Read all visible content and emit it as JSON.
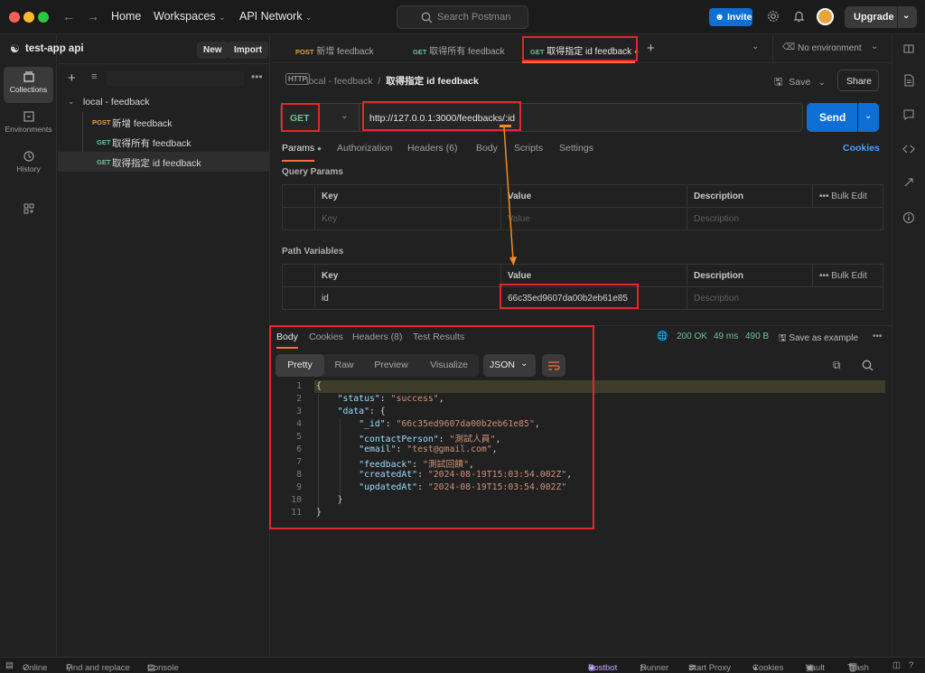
{
  "titlebar": {
    "home": "Home",
    "workspaces": "Workspaces",
    "api_network": "API Network",
    "search_placeholder": "Search Postman",
    "invite": "Invite",
    "upgrade": "Upgrade"
  },
  "rail": {
    "collections": "Collections",
    "environments": "Environments",
    "history": "History"
  },
  "sidebar": {
    "workspace_name": "test-app api",
    "new_label": "New",
    "import_label": "Import",
    "collection_name": "local - feedback",
    "items": [
      {
        "method": "POST",
        "name": "新增 feedback"
      },
      {
        "method": "GET",
        "name": "取得所有 feedback"
      },
      {
        "method": "GET",
        "name": "取得指定 id feedback"
      }
    ]
  },
  "tabs": [
    {
      "method": "POST",
      "name": "新增 feedback"
    },
    {
      "method": "GET",
      "name": "取得所有 feedback"
    },
    {
      "method": "GET",
      "name": "取得指定 id feedback"
    }
  ],
  "environment": "No environment",
  "request": {
    "breadcrumb_parent": "local - feedback",
    "breadcrumb_sep": "/",
    "breadcrumb_current": "取得指定 id feedback",
    "save_label": "Save",
    "share_label": "Share",
    "method": "GET",
    "url": "http://127.0.0.1:3000/feedbacks/:id",
    "send_label": "Send",
    "tabs": [
      "Params",
      "Authorization",
      "Headers (6)",
      "Body",
      "Scripts",
      "Settings"
    ],
    "cookies_label": "Cookies",
    "query_params_title": "Query Params",
    "path_vars_title": "Path Variables",
    "col_key": "Key",
    "col_value": "Value",
    "col_desc": "Description",
    "bulk_edit": "Bulk Edit",
    "ph_key": "Key",
    "ph_value": "Value",
    "ph_desc": "Description",
    "path_var_key": "id",
    "path_var_value": "66c35ed9607da00b2eb61e85"
  },
  "response": {
    "tabs": [
      "Body",
      "Cookies",
      "Headers (8)",
      "Test Results"
    ],
    "status": "200 OK",
    "time": "49 ms",
    "size": "490 B",
    "save_example": "Save as example",
    "views": [
      "Pretty",
      "Raw",
      "Preview",
      "Visualize"
    ],
    "format": "JSON",
    "line_numbers": [
      "1",
      "2",
      "3",
      "4",
      "5",
      "6",
      "7",
      "8",
      "9",
      "10",
      "11"
    ],
    "body": {
      "status": "success",
      "_id": "66c35ed9607da00b2eb61e85",
      "contactPerson": "測試人員",
      "email": "test@gmail.com",
      "feedback": "測試回饋",
      "createdAt": "2024-08-19T15:03:54.002Z",
      "updatedAt": "2024-08-19T15:03:54.002Z"
    }
  },
  "statusbar": {
    "online": "Online",
    "find_replace": "Find and replace",
    "console": "Console",
    "postbot": "Postbot",
    "runner": "Runner",
    "start_proxy": "Start Proxy",
    "cookies": "Cookies",
    "vault": "Vault",
    "trash": "Trash"
  },
  "colors": {
    "accent_orange": "#ff6c37",
    "send_blue": "#0d6fd4",
    "get_green": "#6bc29a",
    "post_orange": "#e8a33a",
    "annotation_red": "#e5262a",
    "status_ok": "#6bc29a"
  }
}
